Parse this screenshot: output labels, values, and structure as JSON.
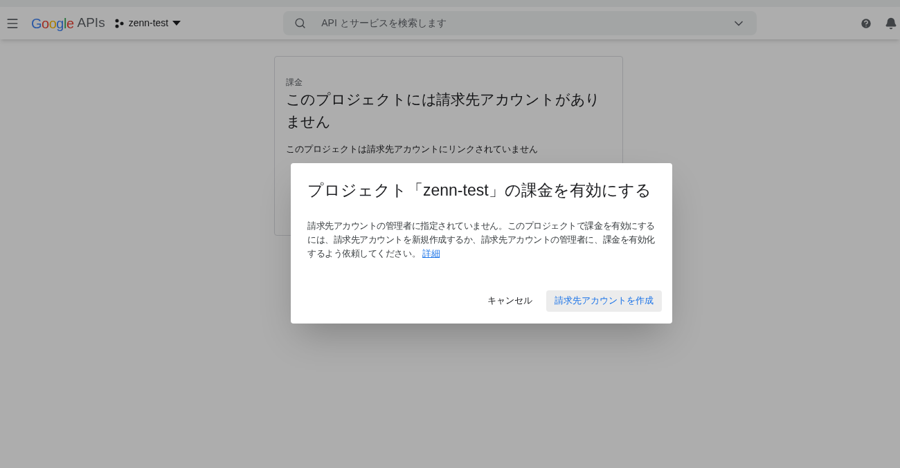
{
  "header": {
    "logo": "Google",
    "logo_suffix": "APIs",
    "project": "zenn-test",
    "search": {
      "placeholder": "API とサービスを検索します"
    }
  },
  "card": {
    "overline": "課金",
    "title": "このプロジェクトには請求先アカウントがありません",
    "text": "このプロジェクトは請求先アカウントにリンクされていません"
  },
  "dialog": {
    "title": "プロジェクト「zenn-test」の課金を有効にする",
    "body": "請求先アカウントの管理者に指定されていません。このプロジェクトで課金を有効にするには、請求先アカウントを新規作成するか、請求先アカウントの管理者に、課金を有効化するよう依頼してください。",
    "link": "詳細",
    "buttons": [
      {
        "label": "キャンセル",
        "kind": "text"
      },
      {
        "label": "請求先アカウントを作成",
        "kind": "tonal"
      }
    ]
  }
}
